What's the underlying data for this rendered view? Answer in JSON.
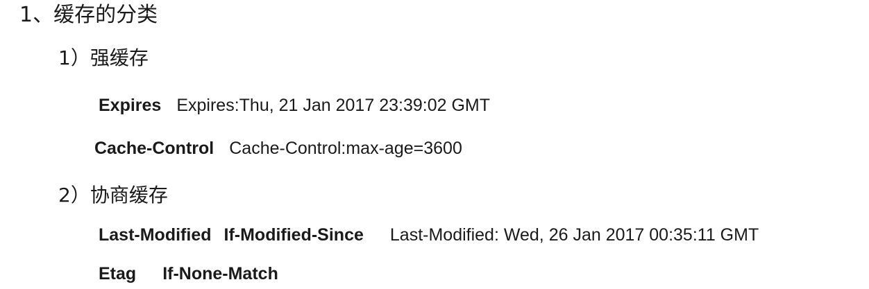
{
  "section": {
    "title": "1、缓存的分类",
    "strong_cache": {
      "heading": "1）强缓存",
      "expires": {
        "key": "Expires",
        "example": "Expires:Thu, 21 Jan 2017 23:39:02 GMT"
      },
      "cache_control": {
        "key": "Cache-Control",
        "example": "Cache-Control:max-age=3600"
      }
    },
    "negotiated_cache": {
      "heading": "2）协商缓存",
      "last_modified": {
        "key": "Last-Modified",
        "key2": "If-Modified-Since",
        "example": "Last-Modified: Wed, 26 Jan 2017 00:35:11 GMT"
      },
      "etag": {
        "key": "Etag",
        "key2": "If-None-Match"
      }
    }
  }
}
